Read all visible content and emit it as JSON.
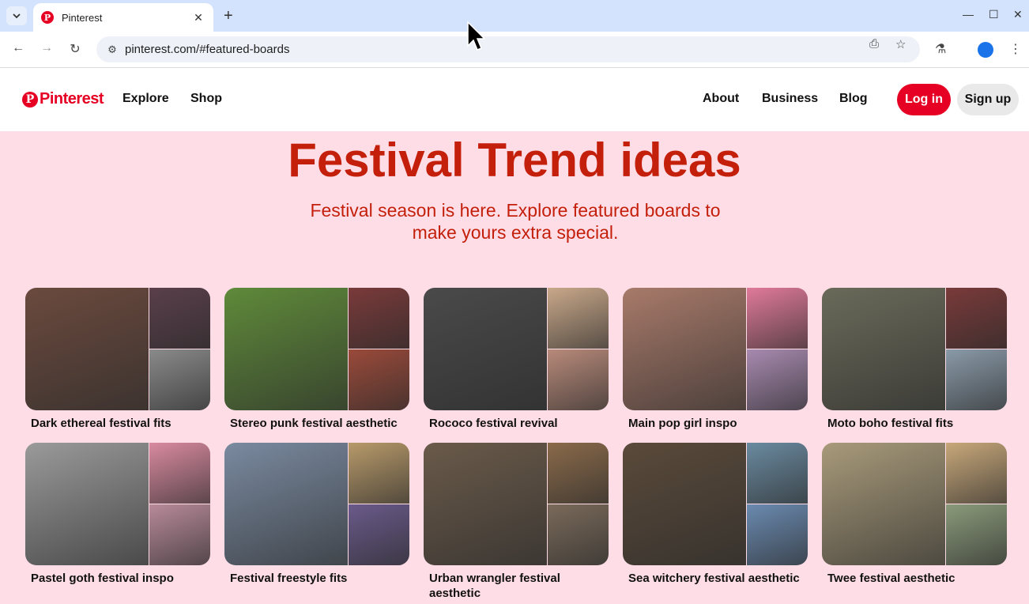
{
  "browser": {
    "tab_title": "Pinterest",
    "tab_favicon": "P",
    "url": "pinterest.com/#featured-boards"
  },
  "header": {
    "logo_mark": "P",
    "logo_text": "Pinterest",
    "nav_left": [
      "Explore",
      "Shop"
    ],
    "nav_right": [
      "About",
      "Business",
      "Blog"
    ],
    "login_label": "Log in",
    "signup_label": "Sign up"
  },
  "hero": {
    "title": "Festival Trend ideas",
    "subtitle": "Festival season is here. Explore featured boards to make yours extra special."
  },
  "boards": [
    {
      "title": "Dark ethereal festival fits",
      "colors": [
        "#6b4a3e",
        "#5a3f4a",
        "#8a8a8a"
      ]
    },
    {
      "title": "Stereo punk festival aesthetic",
      "colors": [
        "#5f8a3a",
        "#7a3a3a",
        "#9a4a3a"
      ]
    },
    {
      "title": "Rococo festival revival",
      "colors": [
        "#4a4a4a",
        "#c9a88a",
        "#b88a7a"
      ]
    },
    {
      "title": "Main pop girl inspo",
      "colors": [
        "#a87a6a",
        "#e07a9a",
        "#a88ab0"
      ]
    },
    {
      "title": "Moto boho festival fits",
      "colors": [
        "#6a6a5a",
        "#7a3a3a",
        "#8a9aa8"
      ]
    },
    {
      "title": "Pastel goth festival inspo",
      "colors": [
        "#9a9a9a",
        "#d98aa0",
        "#b88a9a"
      ]
    },
    {
      "title": "Festival freestyle fits",
      "colors": [
        "#7a8aa0",
        "#b89a6a",
        "#6a5a8a"
      ]
    },
    {
      "title": "Urban wrangler festival aesthetic",
      "colors": [
        "#6a5a4a",
        "#8a6a4a",
        "#7a6a5a"
      ]
    },
    {
      "title": "Sea witchery festival aesthetic",
      "colors": [
        "#5a4a3a",
        "#6a8aa0",
        "#6a8ab0"
      ]
    },
    {
      "title": "Twee festival aesthetic",
      "colors": [
        "#a89a7a",
        "#c8a87a",
        "#8a9a7a"
      ]
    }
  ]
}
